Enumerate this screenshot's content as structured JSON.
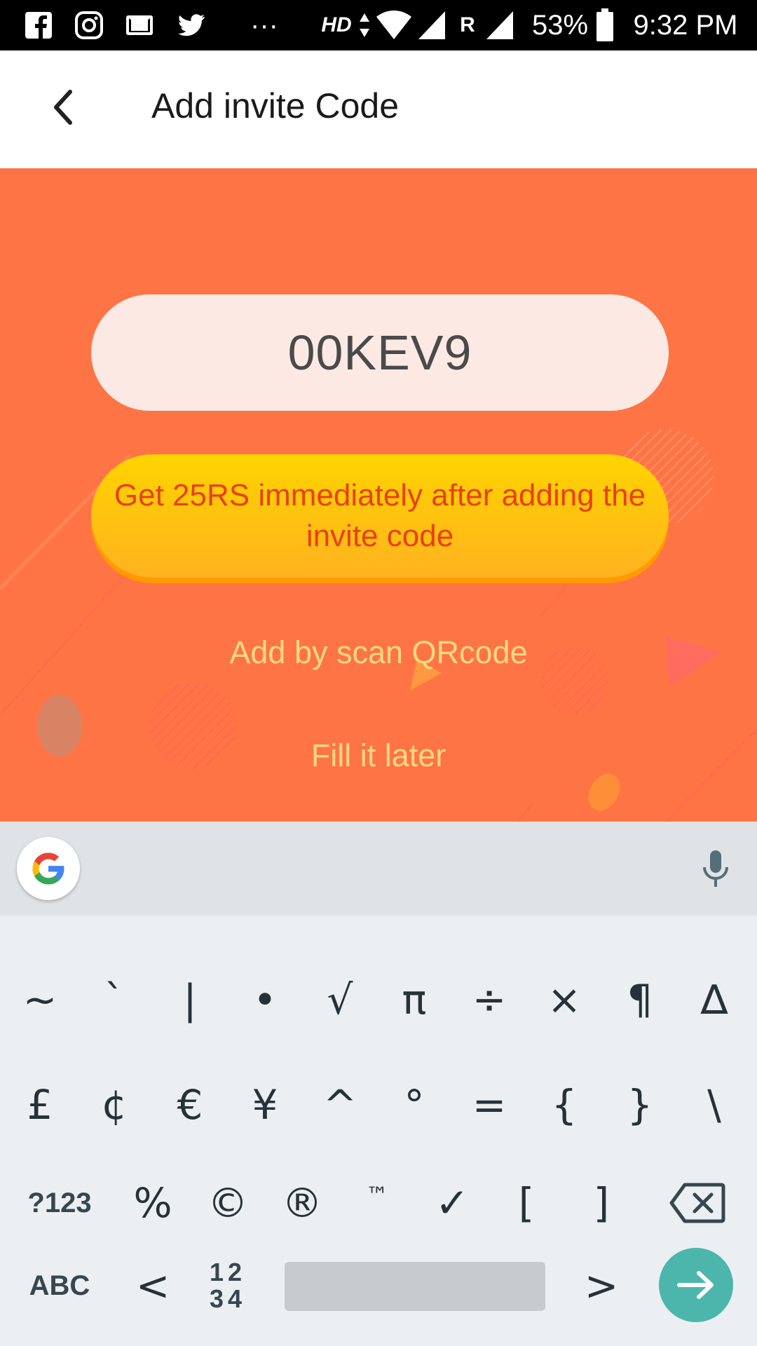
{
  "status_bar": {
    "icons": [
      "facebook-icon",
      "instagram-icon",
      "gmail-icon",
      "twitter-icon",
      "more-icon",
      "wifi-icon",
      "signal-icon",
      "signal-icon",
      "battery-icon"
    ],
    "more": "···",
    "hd": "HD",
    "roaming": "R",
    "battery": "53%",
    "time": "9:32 PM"
  },
  "app_bar": {
    "title": "Add invite Code",
    "back_icon": "chevron-left-icon"
  },
  "invite": {
    "code": "00KEV9",
    "promo_text": "Get 25RS immediately after adding the invite code",
    "scan_link": "Add by scan QRcode",
    "later_link": "Fill it later"
  },
  "colors": {
    "background": "#ff7445",
    "pill": "#fde9e3",
    "button_top": "#ffd400",
    "button_bottom": "#ffb21f",
    "button_text": "#e8410c",
    "link_text": "#ffd980",
    "enter_key": "#4db6ac"
  },
  "keyboard": {
    "row1": [
      "~",
      "`",
      "|",
      "•",
      "√",
      "π",
      "÷",
      "×",
      "¶",
      "∆"
    ],
    "row2": [
      "£",
      "¢",
      "€",
      "¥",
      "^",
      "°",
      "=",
      "{",
      "}",
      "\\"
    ],
    "row3": [
      "?123",
      "%",
      "©",
      "®",
      "™",
      "✓",
      "[",
      "]"
    ],
    "row4": {
      "abc": "ABC",
      "lt": "<",
      "num_top": "12",
      "num_bottom": "34",
      "gt": ">"
    },
    "icons": [
      "google-icon",
      "mic-icon",
      "backspace-icon",
      "arrow-right-icon"
    ]
  }
}
